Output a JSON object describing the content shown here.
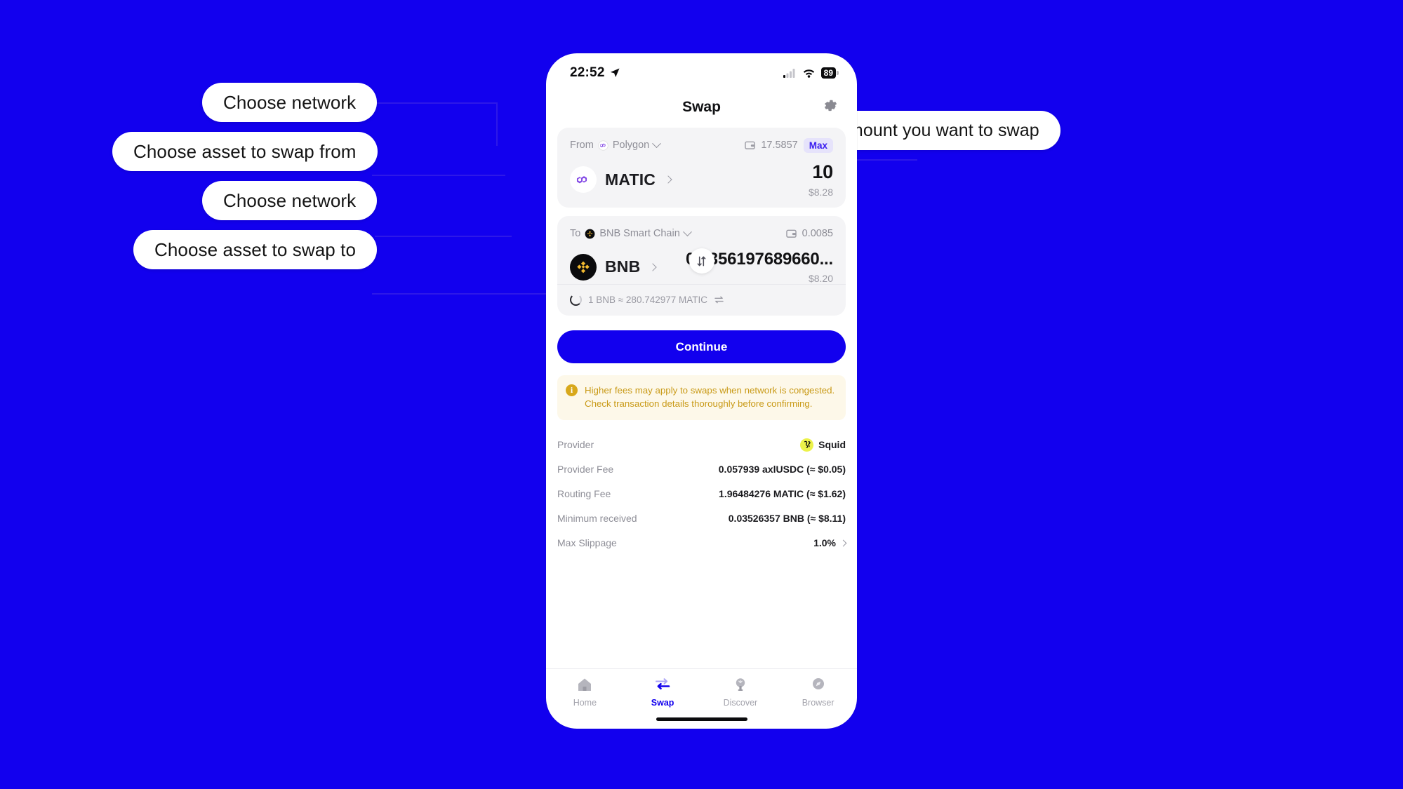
{
  "background_color": "#1200ee",
  "phone": {
    "status_bar": {
      "time": "22:52",
      "location_icon": "location-arrow-icon",
      "signal_icon": "cellular-signal-icon",
      "wifi_icon": "wifi-icon",
      "battery_level": "89"
    },
    "header": {
      "title": "Swap",
      "settings_icon": "gear-icon"
    },
    "swap": {
      "from": {
        "label": "From",
        "network": "Polygon",
        "network_icon": "polygon-network-icon",
        "network_chevron": "chevron-down-icon",
        "wallet_icon": "wallet-icon",
        "balance": "17.5857",
        "max_label": "Max",
        "asset_symbol": "MATIC",
        "asset_icon": "matic-coin-icon",
        "asset_chevron": "chevron-right-icon",
        "amount": "10",
        "usd_value": "$8.28"
      },
      "toggle_icon": "swap-vertical-arrows-icon",
      "to": {
        "label": "To",
        "network": "BNB Smart Chain",
        "network_icon": "bnb-network-icon",
        "network_chevron": "chevron-down-icon",
        "wallet_icon": "wallet-icon",
        "balance": "0.0085",
        "asset_symbol": "BNB",
        "asset_icon": "bnb-coin-icon",
        "asset_chevron": "chevron-right-icon",
        "amount": "0.0356197689660...",
        "usd_value": "$8.20"
      },
      "rate": {
        "spinner_icon": "loading-spinner-icon",
        "text": "1 BNB ≈ 280.742977 MATIC",
        "switch_icon": "switch-rate-icon"
      }
    },
    "continue_label": "Continue",
    "warning": {
      "icon": "info-circle-icon",
      "text": "Higher fees may apply to swaps when network is congested. Check transaction details thoroughly before confirming.",
      "color": "#c99a17",
      "background": "#fdf8e9"
    },
    "details": [
      {
        "key": "Provider",
        "value": "Squid",
        "icon": "squid-logo-icon"
      },
      {
        "key": "Provider Fee",
        "value": "0.057939 axlUSDC (≈ $0.05)"
      },
      {
        "key": "Routing Fee",
        "value": "1.96484276 MATIC (≈ $1.62)"
      },
      {
        "key": "Minimum received",
        "value": "0.03526357 BNB (≈ $8.11)"
      },
      {
        "key": "Max Slippage",
        "value": "1.0%",
        "chevron": "chevron-right-icon"
      }
    ],
    "tabs": [
      {
        "label": "Home",
        "icon": "home-icon",
        "active": false
      },
      {
        "label": "Swap",
        "icon": "swap-arrows-icon",
        "active": true
      },
      {
        "label": "Discover",
        "icon": "lightbulb-icon",
        "active": false
      },
      {
        "label": "Browser",
        "icon": "compass-icon",
        "active": false
      }
    ]
  },
  "callouts": [
    {
      "text": "Choose network"
    },
    {
      "text": "Choose asset to swap from"
    },
    {
      "text": "Choose network"
    },
    {
      "text": "Choose asset to swap to"
    },
    {
      "text": "Choose the amount you want to swap"
    }
  ]
}
